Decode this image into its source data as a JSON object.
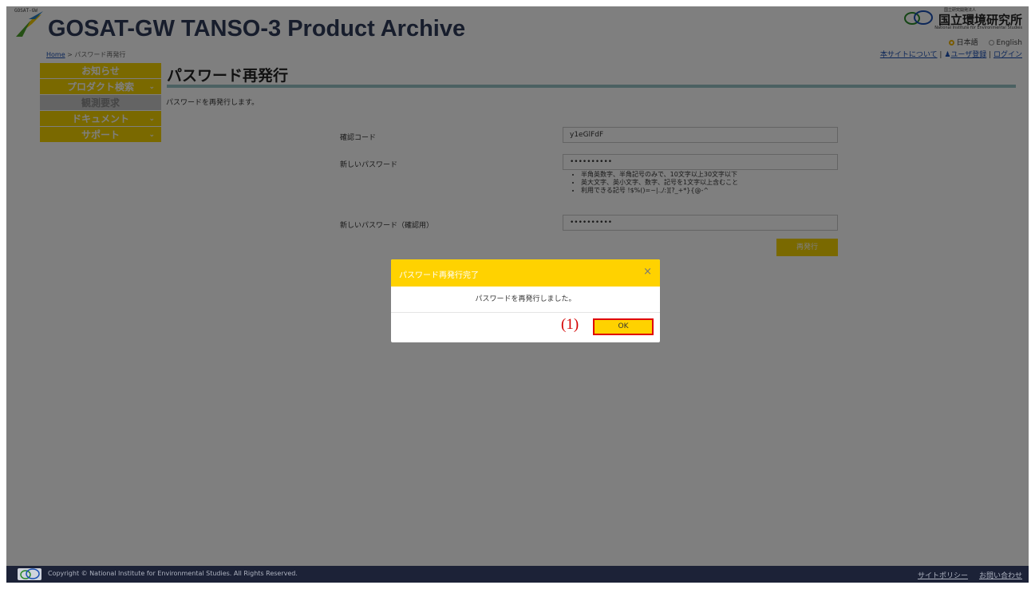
{
  "header": {
    "gosat_tag": "GOSAT-GW",
    "app_title": "GOSAT-GW TANSO-3 Product Archive",
    "nies_small": "国立研究開発法人",
    "nies_name": "国立環境研究所",
    "nies_en": "National Institute for Environmental Studies"
  },
  "breadcrumb": {
    "home": "Home",
    "sep": " > ",
    "current": "パスワード再発行"
  },
  "language": {
    "ja": "日本語",
    "en": "English",
    "selected": "ja"
  },
  "top_links": {
    "about": "本サイトについて",
    "register": "ユーザ登録",
    "login": "ログイン",
    "sep": " | "
  },
  "sidenav": [
    {
      "label": "お知らせ",
      "dropdown": false,
      "disabled": false
    },
    {
      "label": "プロダクト検索",
      "dropdown": true,
      "disabled": false
    },
    {
      "label": "観測要求",
      "dropdown": false,
      "disabled": true
    },
    {
      "label": "ドキュメント",
      "dropdown": true,
      "disabled": false
    },
    {
      "label": "サポート",
      "dropdown": true,
      "disabled": false
    }
  ],
  "main": {
    "title": "パスワード再発行",
    "intro": "パスワードを再発行します。",
    "code_label": "確認コード",
    "code_value": "y1eGlFdF",
    "new_pw_label": "新しいパスワード",
    "new_pw_value": "••••••••••",
    "hints": [
      "半角英数字、半角記号のみで、10文字以上30文字以下",
      "英大文字、英小文字、数字、記号を1文字以上含むこと",
      "利用できる記号 !$%()=~|.,/:][?_+*}{@-^"
    ],
    "confirm_pw_label": "新しいパスワード（確認用）",
    "confirm_pw_value": "••••••••••",
    "reissue_button": "再発行"
  },
  "modal": {
    "title": "パスワード再発行完了",
    "close": "×",
    "message": "パスワードを再発行しました。",
    "ok_button": "OK",
    "annotation": "(1)"
  },
  "footer": {
    "copyright": "Copyright © National Institute for Environmental Studies. All Rights Reserved.",
    "policy": "サイトポリシー",
    "contact": "お問い合わせ"
  },
  "colors": {
    "accent_yellow": "#f5d300",
    "modal_yellow": "#ffd200",
    "annotation_red": "#e00000",
    "footer_bg": "#1c2237",
    "rule_teal": "#97c3c4"
  }
}
